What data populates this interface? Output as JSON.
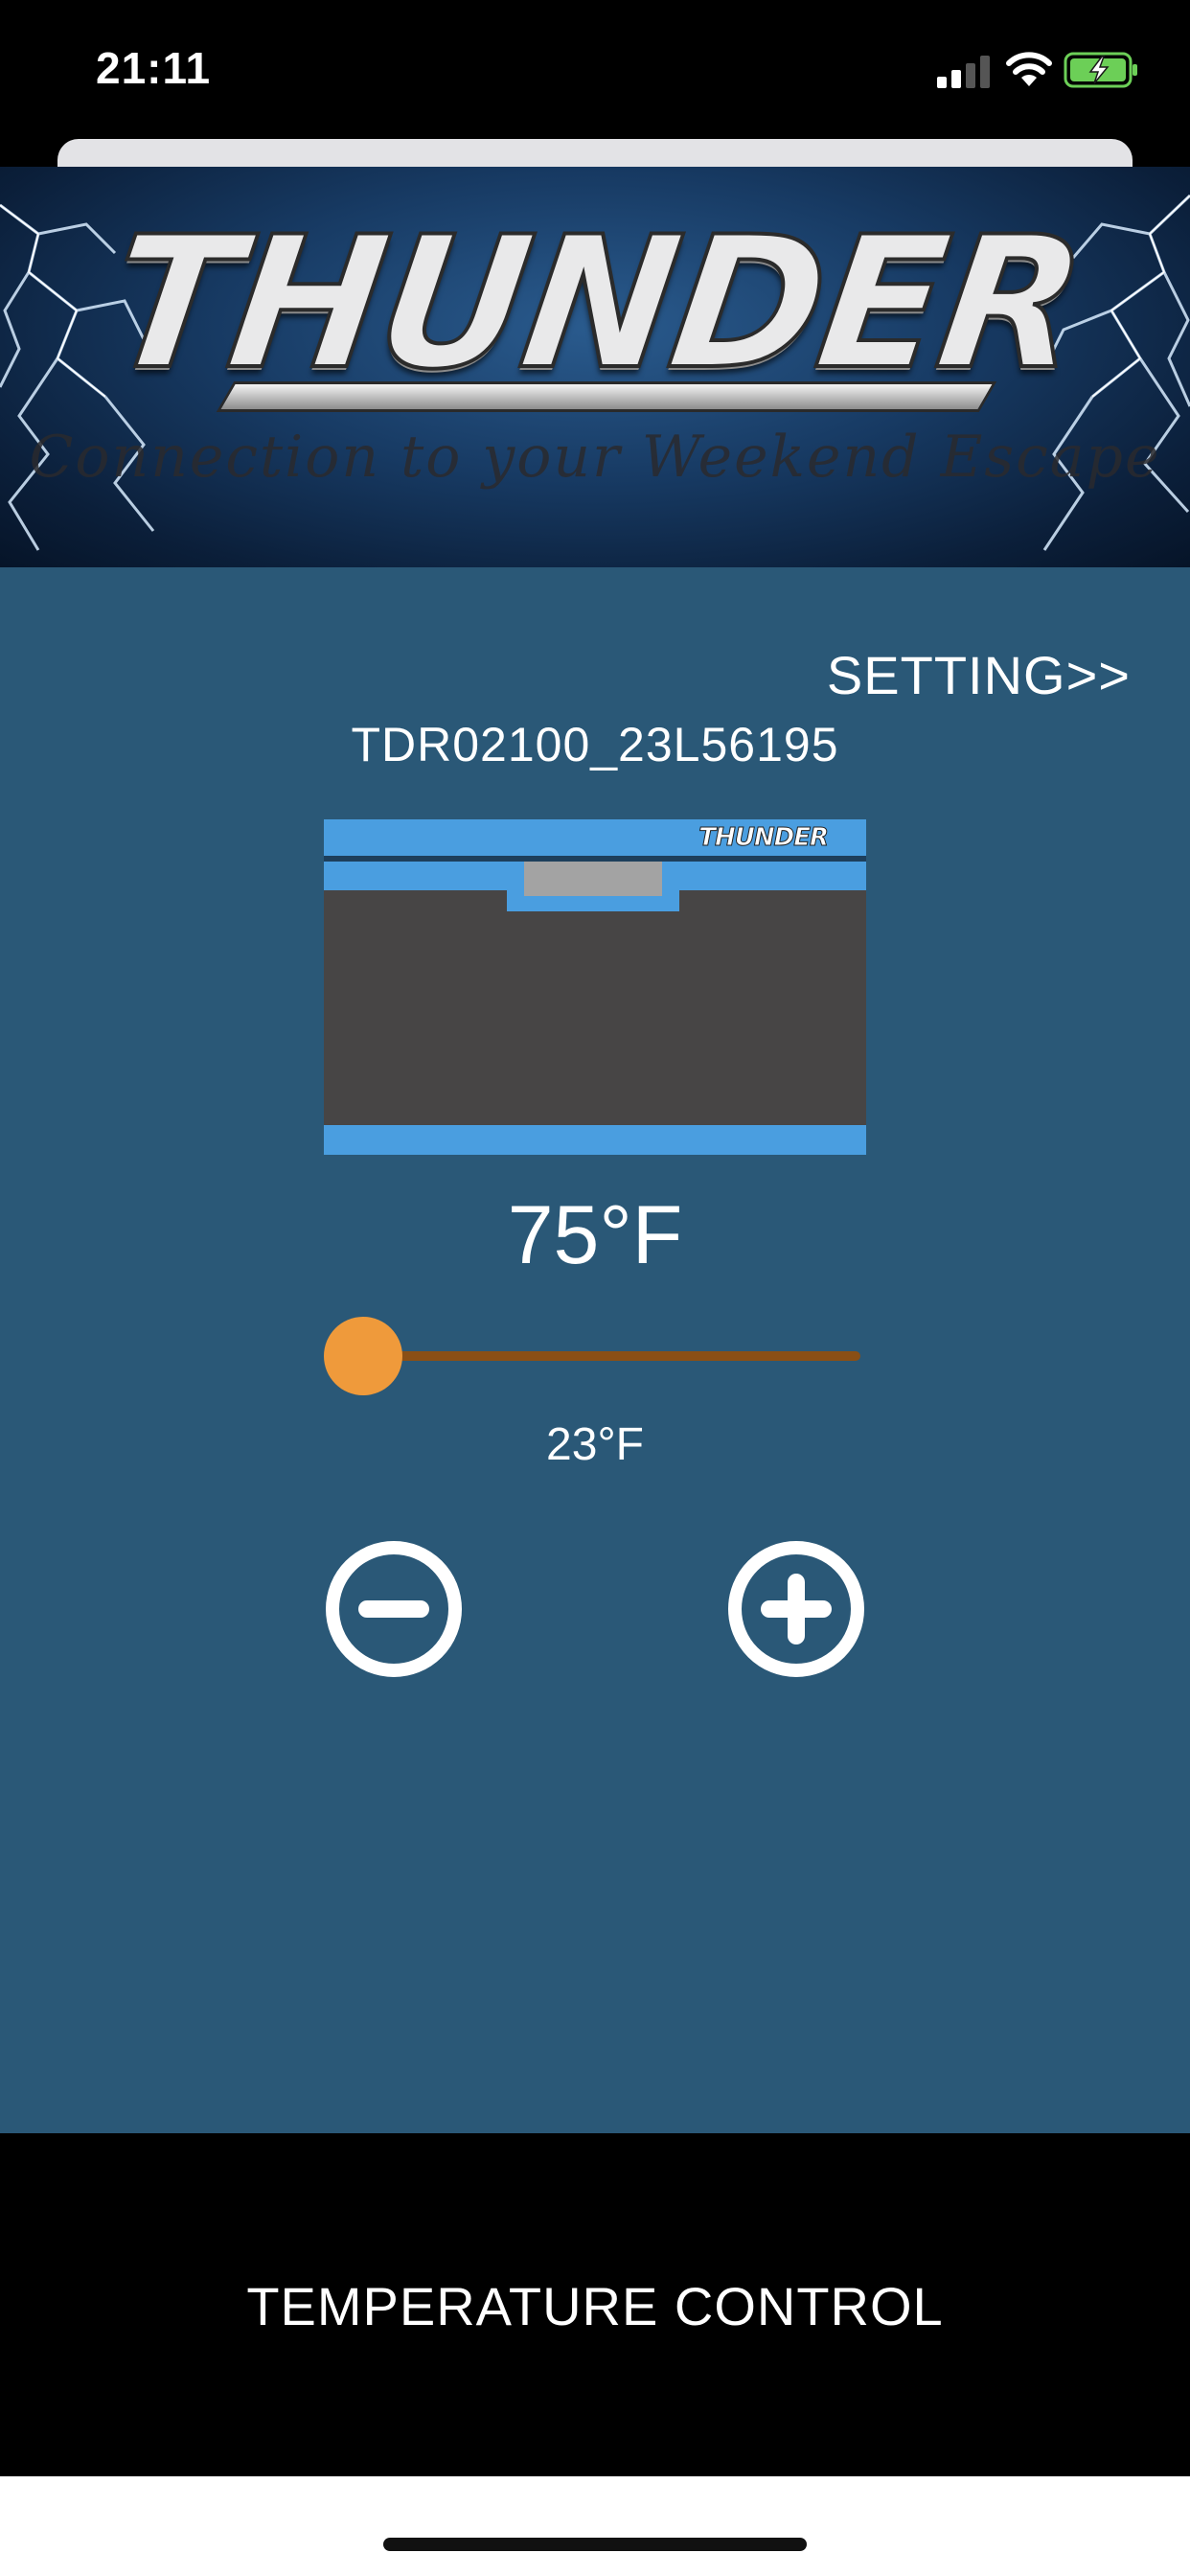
{
  "status_bar": {
    "time": "21:11",
    "icons": [
      "signal-icon",
      "wifi-icon",
      "battery-charging-icon"
    ]
  },
  "banner": {
    "logo": "THUNDER",
    "tagline": "Connection to your Weekend Escape"
  },
  "main": {
    "setting_link": "SETTING>>",
    "device_id": "TDR02100_23L56195",
    "fridge_logo": "THUNDER",
    "set_temperature": "75°F",
    "slider": {
      "fraction": 0.0
    },
    "current_temperature": "23°F",
    "decrease_icon": "minus-circle-icon",
    "increase_icon": "plus-circle-icon"
  },
  "tab_bar": {
    "label": "TEMPERATURE CONTROL"
  },
  "colors": {
    "panel_bg": "#2a5877",
    "accent_blue": "#4a9ee0",
    "slider_thumb": "#ef9a3b",
    "slider_track": "#8a4f15",
    "fridge_body": "#474545"
  }
}
